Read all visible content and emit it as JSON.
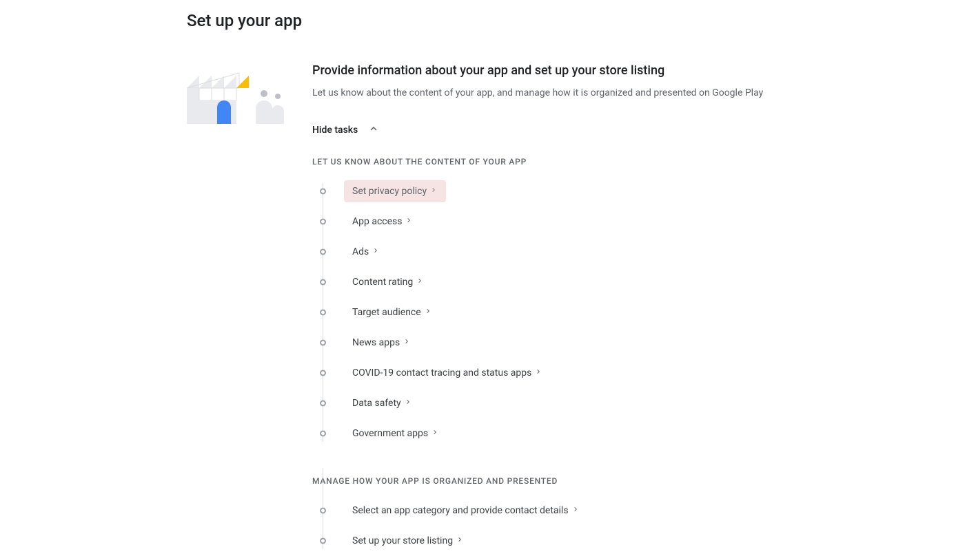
{
  "page": {
    "title": "Set up your app"
  },
  "section": {
    "title": "Provide information about your app and set up your store listing",
    "description": "Let us know about the content of your app, and manage how it is organized and presented on Google Play",
    "toggle_label": "Hide tasks"
  },
  "groups": [
    {
      "header": "LET US KNOW ABOUT THE CONTENT OF YOUR APP",
      "tasks": [
        {
          "label": "Set privacy policy",
          "highlighted": true
        },
        {
          "label": "App access",
          "highlighted": false
        },
        {
          "label": "Ads",
          "highlighted": false
        },
        {
          "label": "Content rating",
          "highlighted": false
        },
        {
          "label": "Target audience",
          "highlighted": false
        },
        {
          "label": "News apps",
          "highlighted": false
        },
        {
          "label": "COVID-19 contact tracing and status apps",
          "highlighted": false
        },
        {
          "label": "Data safety",
          "highlighted": false
        },
        {
          "label": "Government apps",
          "highlighted": false
        }
      ]
    },
    {
      "header": "MANAGE HOW YOUR APP IS ORGANIZED AND PRESENTED",
      "tasks": [
        {
          "label": "Select an app category and provide contact details",
          "highlighted": false
        },
        {
          "label": "Set up your store listing",
          "highlighted": false
        }
      ]
    }
  ]
}
